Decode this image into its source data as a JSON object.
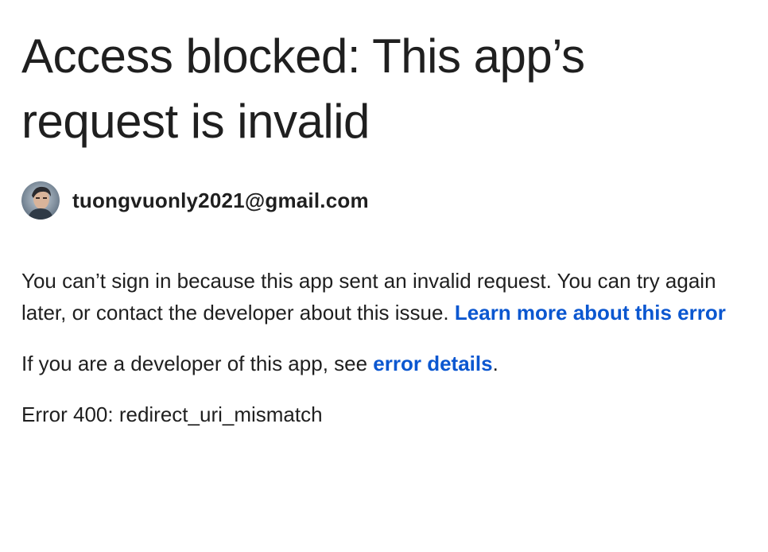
{
  "page": {
    "title": "Access blocked: This app’s request is invalid",
    "account": {
      "email": "tuongvuonly2021@gmail.com"
    },
    "message": {
      "text": "You can’t sign in because this app sent an invalid request. You can try again later, or contact the developer about this issue. ",
      "learn_more_link": "Learn more about this error"
    },
    "developer_note": {
      "prefix": "If you are a developer of this app, see ",
      "link": "error details",
      "suffix": "."
    },
    "error_code": "Error 400: redirect_uri_mismatch"
  },
  "colors": {
    "text": "#1f1f1f",
    "link": "#0b57d0",
    "background": "#ffffff"
  },
  "icons": {
    "avatar": "user-avatar-photo"
  }
}
